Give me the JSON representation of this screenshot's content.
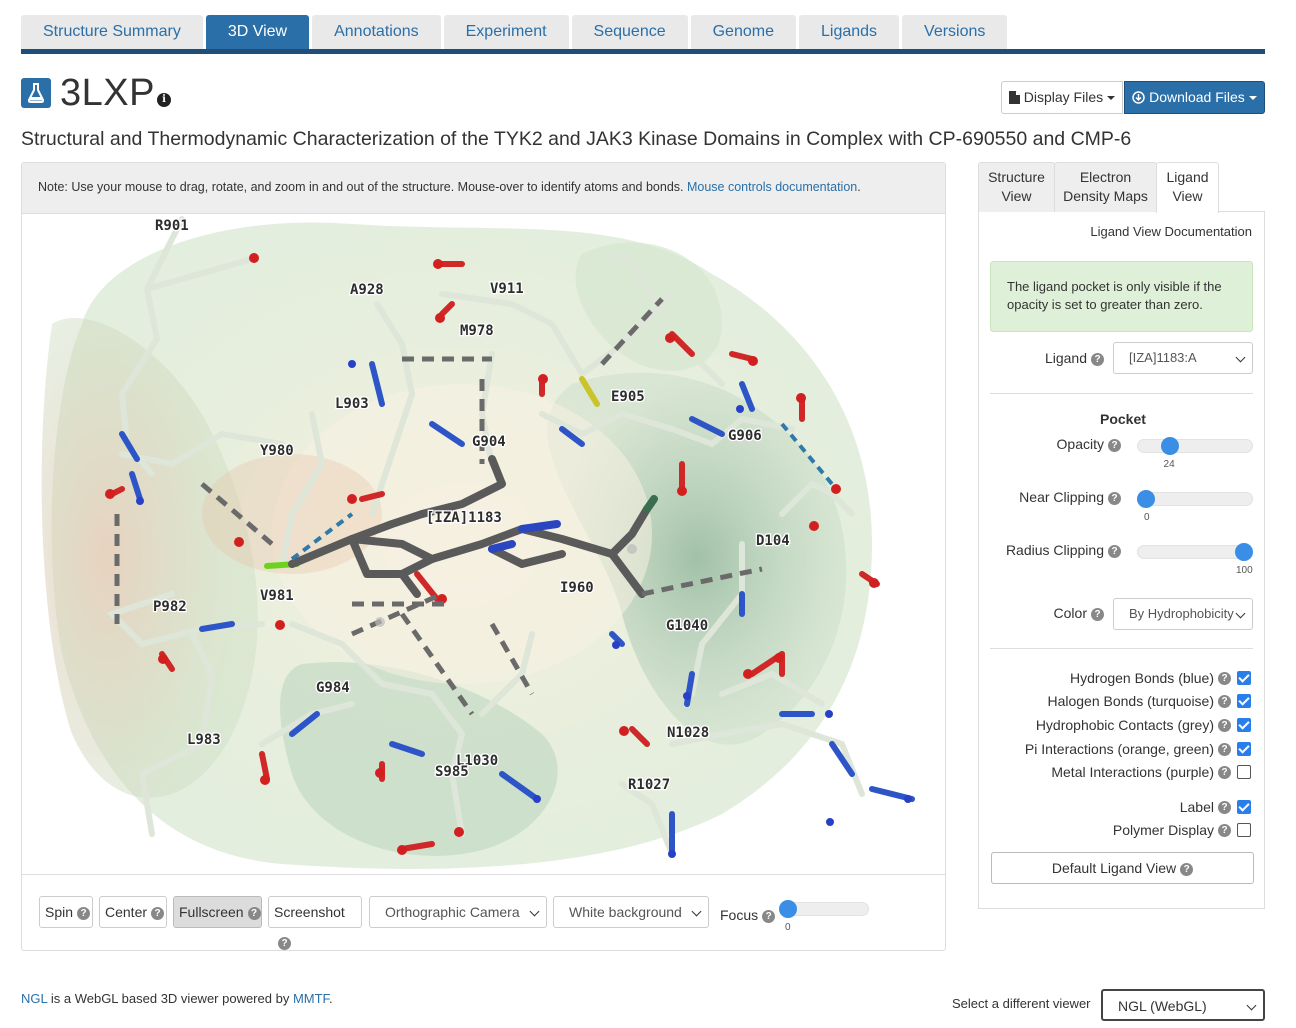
{
  "tabs": [
    "Structure Summary",
    "3D View",
    "Annotations",
    "Experiment",
    "Sequence",
    "Genome",
    "Ligands",
    "Versions"
  ],
  "active_tab": "3D View",
  "header": {
    "pdb_id": "3LXP",
    "display_files": "Display Files",
    "download_files": "Download Files",
    "title": "Structural and Thermodynamic Characterization of the TYK2 and JAK3 Kinase Domains in Complex with CP-690550 and CMP-6"
  },
  "viewer": {
    "note_text": "Note: Use your mouse to drag, rotate, and zoom in and out of the structure. Mouse-over to identify atoms and bonds.",
    "note_link": "Mouse controls documentation",
    "residue_labels": [
      "R901",
      "A928",
      "V911",
      "M978",
      "L903",
      "Y980",
      "E905",
      "G904",
      "G906",
      "[IZA]1183",
      "D104",
      "I960",
      "G1040",
      "P982",
      "V981",
      "G984",
      "L983",
      "N1028",
      "L1030",
      "S985",
      "R1027"
    ],
    "controls": {
      "spin": "Spin",
      "center": "Center",
      "fullscreen": "Fullscreen",
      "screenshot": "Screenshot",
      "camera": "Orthographic Camera",
      "background": "White background",
      "focus_label": "Focus",
      "focus_value": "0"
    }
  },
  "right_panel": {
    "tabs": [
      {
        "line1": "Structure",
        "line2": "View"
      },
      {
        "line1": "Electron",
        "line2": "Density Maps"
      },
      {
        "line1": "Ligand",
        "line2": "View"
      }
    ],
    "doc_link": "Ligand View Documentation",
    "alert": "The ligand pocket is only visible if the opacity is set to greater than zero.",
    "ligand_label": "Ligand",
    "ligand_value": "[IZA]1183:A",
    "pocket_heading": "Pocket",
    "opacity_label": "Opacity",
    "opacity_value": "24",
    "opacity_fraction": 0.24,
    "near_label": "Near Clipping",
    "near_value": "0",
    "radius_label": "Radius Clipping",
    "radius_value": "100",
    "color_label": "Color",
    "color_value": "By Hydrophobicity",
    "checkboxes": [
      {
        "label": "Hydrogen Bonds (blue)",
        "checked": true
      },
      {
        "label": "Halogen Bonds (turquoise)",
        "checked": true
      },
      {
        "label": "Hydrophobic Contacts (grey)",
        "checked": true
      },
      {
        "label": "Pi Interactions (orange, green)",
        "checked": true
      },
      {
        "label": "Metal Interactions (purple)",
        "checked": false
      },
      {
        "label": "Label",
        "checked": true
      },
      {
        "label": "Polymer Display",
        "checked": false
      }
    ],
    "default_button": "Default Ligand View"
  },
  "footer": {
    "ngl": "NGL",
    "ngl_text": " is a WebGL based 3D viewer powered by ",
    "mmtf": "MMTF",
    "period": ".",
    "select_label": "Select a different viewer",
    "viewer_value": "NGL (WebGL)"
  },
  "colors": {
    "accent": "#2a6fa8",
    "nav_bar": "#1f4e7a",
    "checkbox": "#2a7ee8",
    "alert_bg": "#dff0d8"
  }
}
